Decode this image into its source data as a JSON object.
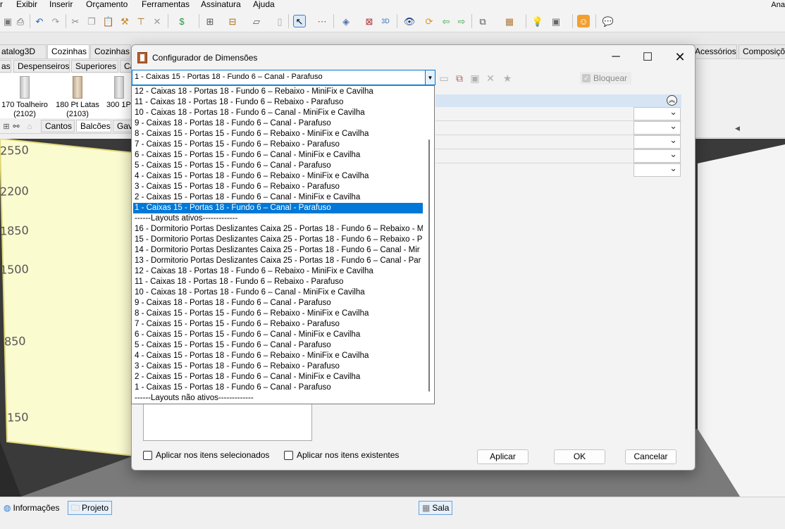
{
  "app": {
    "menu": [
      "r",
      "Exibir",
      "Inserir",
      "Orçamento",
      "Ferramentas",
      "Assinatura",
      "Ajuda"
    ],
    "user": "Ana",
    "category_tabs": [
      "atalog3D",
      "Cozinhas",
      "Cozinhas s",
      "Acessórios",
      "Composiçõ"
    ],
    "sub_tabs": [
      "as",
      "Despenseiros",
      "Superiores",
      "Ca"
    ],
    "catalog_items": [
      {
        "name": "170 Toalheiro",
        "code": "(2102)"
      },
      {
        "name": "180 Pt Latas",
        "code": "(2103)"
      },
      {
        "name": "300 1P",
        "code": ""
      }
    ],
    "view_tabs": [
      "Cantos",
      "Balcões",
      "Gav"
    ],
    "scene_dimensions": [
      "2550",
      "2200",
      "1850",
      "1500",
      "850",
      "150"
    ],
    "status_tabs": {
      "info": "Informações",
      "project": "Projeto",
      "room": "Sala"
    }
  },
  "dialog": {
    "title": "Configurador de Dimensões",
    "selected_layout": "1 - Caixas 15 - Portas 18 - Fundo 6 – Canal - Parafuso",
    "lock_label": "Bloquear",
    "apply_selected_label": "Aplicar nos itens selecionados",
    "apply_existing_label": "Aplicar nos itens existentes",
    "apply_button": "Aplicar",
    "ok_button": "OK",
    "cancel_button": "Cancelar"
  },
  "dropdown_options": [
    "12 - Caixas 18 - Portas 18 - Fundo 6 – Rebaixo - MiniFix e Cavilha",
    "11 - Caixas 18 - Portas 18 - Fundo 6 – Rebaixo - Parafuso",
    "10 - Caixas 18 - Portas 18 - Fundo 6 – Canal - MiniFix e Cavilha",
    "9 - Caixas 18 - Portas 18 - Fundo 6 – Canal - Parafuso",
    "8 - Caixas 15 - Portas 15 - Fundo 6 – Rebaixo - MiniFix  e Cavilha",
    "7 - Caixas 15 - Portas 15 - Fundo 6 – Rebaixo - Parafuso",
    "6 - Caixas 15 - Portas 15 - Fundo 6 – Canal - MiniFix e Cavilha",
    "5 - Caixas 15 - Portas 15 - Fundo 6 – Canal - Parafuso",
    "4 - Caixas 15 - Portas 18 - Fundo 6 – Rebaixo - MiniFix e Cavilha",
    "3 - Caixas 15 - Portas 18 - Fundo 6 – Rebaixo - Parafuso",
    "2 - Caixas 15 - Portas 18 - Fundo 6 – Canal - MiniFix e Cavilha",
    "1 - Caixas 15 - Portas 18 - Fundo 6 – Canal - Parafuso",
    "------Layouts ativos-------------",
    "16 - Dormitorio Portas Deslizantes Caixa 25 - Portas 18 - Fundo 6 – Rebaixo - M",
    "15 - Dormitorio Portas Deslizantes Caixa 25 - Portas 18 - Fundo 6 – Rebaixo - P",
    "14 - Dormitorio Portas Deslizantes Caixa 25 - Portas 18 - Fundo 6 – Canal - Mir",
    "13 - Dormitorio Portas Deslizantes Caixa 25 - Portas 18 - Fundo 6 – Canal - Par",
    "12 - Caixas 18 - Portas 18 - Fundo 6 – Rebaixo - MiniFix e Cavilha",
    "11 - Caixas 18 - Portas 18 - Fundo 6 – Rebaixo - Parafuso",
    "10 - Caixas 18 - Portas 18 - Fundo 6 – Canal - MiniFix e Cavilha",
    "9 - Caixas 18 - Portas 18 - Fundo 6 – Canal - Parafuso",
    "8 - Caixas 15 - Portas 15 - Fundo 6 – Rebaixo - MiniFix  e Cavilha",
    "7 - Caixas 15 - Portas 15 - Fundo 6 – Rebaixo - Parafuso",
    "6 - Caixas 15 - Portas 15 - Fundo 6 – Canal - MiniFix e Cavilha",
    "5 - Caixas 15 - Portas 15 - Fundo 6 – Canal - Parafuso",
    "4 - Caixas 15 - Portas 18 - Fundo 6 – Rebaixo - MiniFix e Cavilha",
    "3 - Caixas 15 - Portas 18 - Fundo 6 – Rebaixo - Parafuso",
    "2 - Caixas 15 - Portas 18 - Fundo 6 – Canal - MiniFix e Cavilha",
    "1 - Caixas 15 - Portas 18 - Fundo 6 – Canal - Parafuso",
    "------Layouts não ativos-------------"
  ],
  "highlighted_option_index": 11,
  "colors": {
    "accent": "#0078d7",
    "wall": "#fbfbd0",
    "scene_bg": "#3a3a3a"
  }
}
